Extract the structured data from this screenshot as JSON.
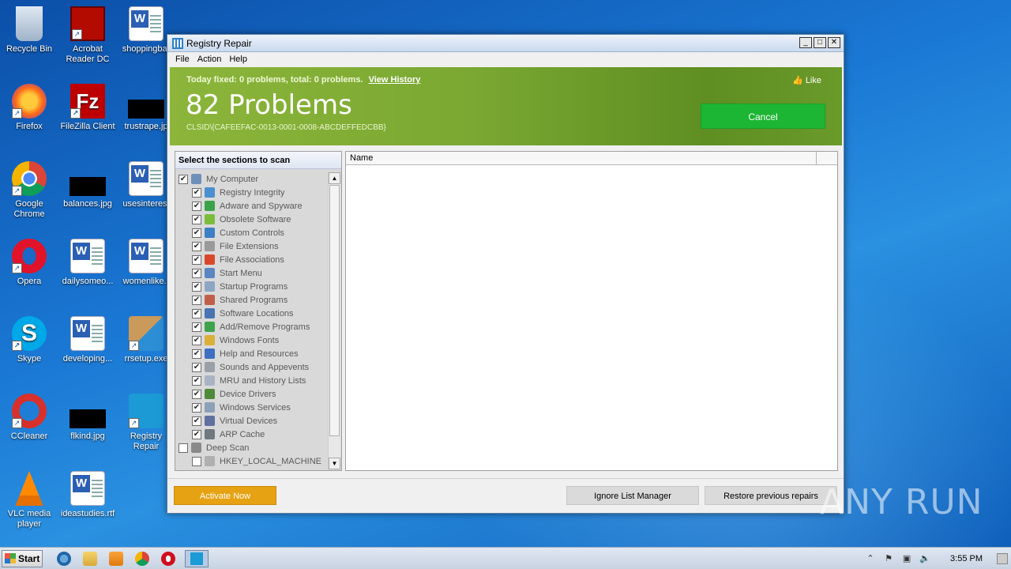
{
  "desktop": {
    "icons": [
      {
        "label": "Recycle Bin",
        "icon": "recycle-bin-icon"
      },
      {
        "label": "Acrobat Reader DC",
        "icon": "acrobat-icon"
      },
      {
        "label": "shoppingbar",
        "icon": "word-doc-icon"
      },
      {
        "label": "Firefox",
        "icon": "firefox-icon"
      },
      {
        "label": "FileZilla Client",
        "icon": "filezilla-icon"
      },
      {
        "label": "trustrape.jp",
        "icon": "image-file-icon"
      },
      {
        "label": "Google Chrome",
        "icon": "chrome-icon"
      },
      {
        "label": "balances.jpg",
        "icon": "image-file-icon"
      },
      {
        "label": "usesinteres.",
        "icon": "word-doc-icon"
      },
      {
        "label": "Opera",
        "icon": "opera-icon"
      },
      {
        "label": "dailysomeo...",
        "icon": "word-doc-icon"
      },
      {
        "label": "womenlike.r",
        "icon": "word-doc-icon"
      },
      {
        "label": "Skype",
        "icon": "skype-icon"
      },
      {
        "label": "developing...",
        "icon": "word-doc-icon"
      },
      {
        "label": "rrsetup.exe",
        "icon": "installer-icon"
      },
      {
        "label": "CCleaner",
        "icon": "ccleaner-icon"
      },
      {
        "label": "flkind.jpg",
        "icon": "image-file-icon"
      },
      {
        "label": "Registry Repair",
        "icon": "registry-repair-icon"
      },
      {
        "label": "VLC media player",
        "icon": "vlc-icon"
      },
      {
        "label": "ideastudies.rtf",
        "icon": "word-doc-icon"
      }
    ]
  },
  "window": {
    "title": "Registry Repair",
    "menu": [
      "File",
      "Action",
      "Help"
    ],
    "controls": {
      "minimize": "_",
      "maximize": "□",
      "close": "✕"
    }
  },
  "banner": {
    "today_text": "Today fixed: 0 problems, total: 0 problems.",
    "view_history": "View History",
    "like": "Like",
    "problems": "82 Problems",
    "clsid": "CLSID\\{CAFEEFAC-0013-0001-0008-ABCDEFFEDCBB}",
    "cancel": "Cancel"
  },
  "scan_panel": {
    "header": "Select the sections to scan",
    "items": [
      {
        "label": "My Computer",
        "level": 0,
        "checked": true,
        "color": "#6e8fb8"
      },
      {
        "label": "Registry Integrity",
        "level": 1,
        "checked": true,
        "color": "#4a8fd0"
      },
      {
        "label": "Adware and Spyware",
        "level": 1,
        "checked": true,
        "color": "#3aa34a"
      },
      {
        "label": "Obsolete Software",
        "level": 1,
        "checked": true,
        "color": "#7bbd3a"
      },
      {
        "label": "Custom Controls",
        "level": 1,
        "checked": true,
        "color": "#3b7fc4"
      },
      {
        "label": "File Extensions",
        "level": 1,
        "checked": true,
        "color": "#9a9a9a"
      },
      {
        "label": "File Associations",
        "level": 1,
        "checked": true,
        "color": "#d9472b"
      },
      {
        "label": "Start Menu",
        "level": 1,
        "checked": true,
        "color": "#5b87c0"
      },
      {
        "label": "Startup Programs",
        "level": 1,
        "checked": true,
        "color": "#8da6c4"
      },
      {
        "label": "Shared Programs",
        "level": 1,
        "checked": true,
        "color": "#c0604a"
      },
      {
        "label": "Software Locations",
        "level": 1,
        "checked": true,
        "color": "#4a74b2"
      },
      {
        "label": "Add/Remove Programs",
        "level": 1,
        "checked": true,
        "color": "#3fa34d"
      },
      {
        "label": "Windows Fonts",
        "level": 1,
        "checked": true,
        "color": "#d8b03a"
      },
      {
        "label": "Help and Resources",
        "level": 1,
        "checked": true,
        "color": "#3e6fc0"
      },
      {
        "label": "Sounds and Appevents",
        "level": 1,
        "checked": true,
        "color": "#9aa0a8"
      },
      {
        "label": "MRU and History Lists",
        "level": 1,
        "checked": true,
        "color": "#a8b4c4"
      },
      {
        "label": "Device Drivers",
        "level": 1,
        "checked": true,
        "color": "#4f8a3a"
      },
      {
        "label": "Windows Services",
        "level": 1,
        "checked": true,
        "color": "#8ca0b8"
      },
      {
        "label": "Virtual Devices",
        "level": 1,
        "checked": true,
        "color": "#6070a0"
      },
      {
        "label": "ARP Cache",
        "level": 1,
        "checked": true,
        "color": "#707880"
      },
      {
        "label": "Deep Scan",
        "level": 0,
        "checked": false,
        "color": "#8a8a8a"
      },
      {
        "label": "HKEY_LOCAL_MACHINE",
        "level": 1,
        "checked": false,
        "color": "#b0b0b0"
      }
    ]
  },
  "results": {
    "column_name": "Name"
  },
  "footer": {
    "activate": "Activate Now",
    "ignore_list": "Ignore List Manager",
    "restore": "Restore previous repairs"
  },
  "taskbar": {
    "start": "Start",
    "clock": "3:55 PM"
  },
  "watermark": "ANY RUN"
}
